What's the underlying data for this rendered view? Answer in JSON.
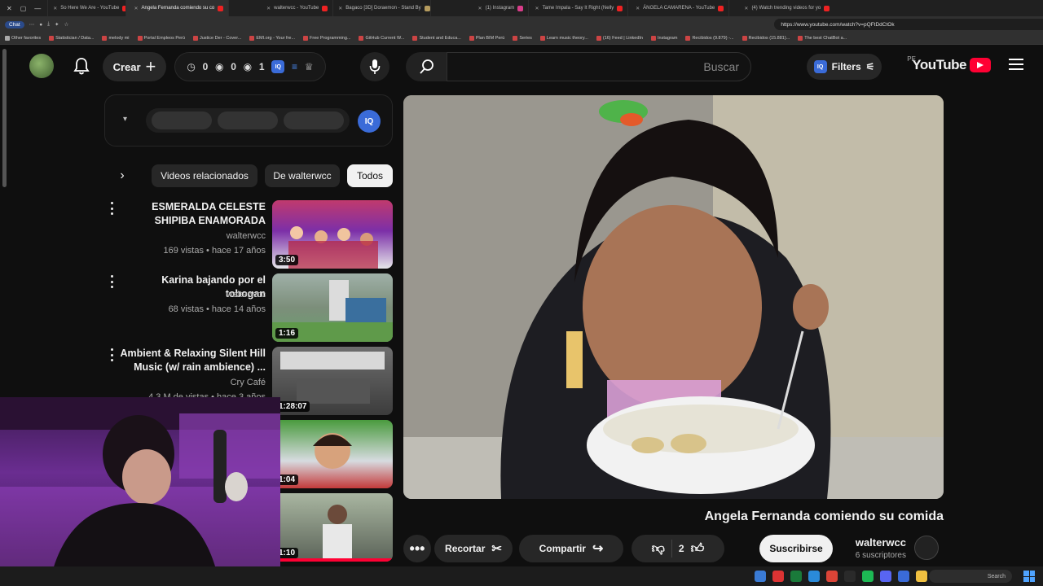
{
  "browser": {
    "tabs": [
      {
        "label": "(4) Watch trending videos for yo"
      },
      {
        "label": "ÁNGELA CAMARENA - YouTube"
      },
      {
        "label": "Tame Impala - Say It Right (Nelly"
      },
      {
        "label": "(1) Instagram"
      },
      {
        "label": "Bagaco [3D] Doraemon - Stand By"
      },
      {
        "label": "walterwcc - YouTube"
      },
      {
        "label": "Angela Fernanda comiendo su co"
      },
      {
        "label": "So Here We Are - YouTube"
      }
    ],
    "url": "https://www.youtube.com/watch?v=pQFtDdCtOk",
    "bookmarks": [
      "The best ChatBot a...",
      "Recibidos (15.881)...",
      "Recibidos (9.879) -...",
      "Instagram",
      "(16) Feed | LinkedIn",
      "Learn music theory...",
      "Series",
      "Plan BIM Perú",
      "Student and Educa...",
      "GitHub Current W...",
      "Free Programming...",
      "EMI.org - Your fre...",
      "Justice Der - Cover...",
      "Portal Empleos Perú",
      "melody mi",
      "Statistician / Data...",
      "Other favorites"
    ],
    "chat_label": "Chat"
  },
  "header": {
    "logo_text": "YouTube",
    "region": "PE",
    "filters_label": "Filters",
    "ext_badge": "IQ",
    "search_placeholder": "Buscar",
    "stats": {
      "a": "1",
      "b": "0",
      "c": "0"
    },
    "create_label": "Crear",
    "icons": [
      "menu-icon",
      "youtube-logo-icon",
      "search-icon",
      "mic-icon",
      "bell-icon",
      "trophy-icon",
      "eye-icon",
      "clock-icon",
      "plus-icon"
    ]
  },
  "video": {
    "title": "Angela Fernanda comiendo su comida",
    "channel": "walterwcc",
    "subscribers": "6 suscriptores",
    "subscribe_label": "Suscribirse",
    "likes": "2",
    "share_label": "Compartir",
    "clip_label": "Recortar",
    "more_label": "•••"
  },
  "ext_panel": {
    "badge": "IQ"
  },
  "chips": [
    {
      "label": "Todos",
      "active": true
    },
    {
      "label": "De walterwcc",
      "active": false
    },
    {
      "label": "Videos relacionados",
      "active": false
    }
  ],
  "related": [
    {
      "title": "ESMERALDA CELESTE SHIPIBA ENAMORADA",
      "channel": "walterwcc",
      "meta": "169 vistas • hace 17 años",
      "duration": "3:50"
    },
    {
      "title": "Karina bajando por el tobogan",
      "channel": "walterwcc",
      "meta": "68 vistas • hace 14 años",
      "duration": "1:16"
    },
    {
      "title": "Ambient & Relaxing Silent Hill Music (w/ rain ambience) ...",
      "channel": "Cry Café",
      "meta": "4.3 M de vistas • hace 3 años",
      "duration": "1:28:07"
    },
    {
      "title": "",
      "channel": "",
      "meta": "",
      "duration": "1:04"
    },
    {
      "title": "",
      "channel": "",
      "meta": "",
      "duration": "1:10"
    }
  ],
  "taskbar": {
    "search_label": "Search"
  },
  "colors": {
    "bg": "#0f0f0f",
    "accent": "#ff0033",
    "ext_blue": "#3a6bd8",
    "webcam_purple": "#6a2d91"
  }
}
